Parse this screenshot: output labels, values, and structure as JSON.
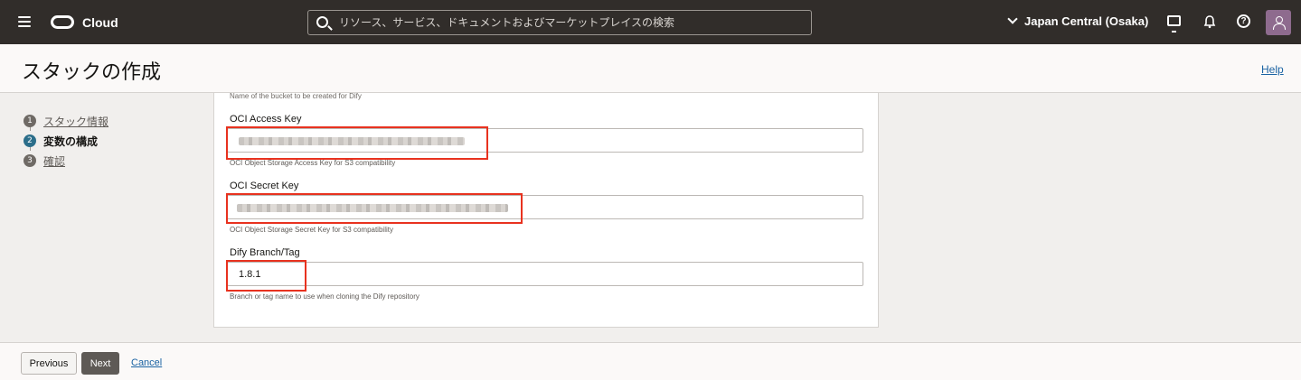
{
  "topbar": {
    "brand": "Cloud",
    "search_placeholder": "リソース、サービス、ドキュメントおよびマーケットプレイスの検索",
    "region": "Japan Central (Osaka)",
    "icons": [
      "menu-icon",
      "oracle-logo",
      "search-icon",
      "chevron-down-icon",
      "cloud-shell-icon",
      "bell-icon",
      "help-icon",
      "user-avatar-icon"
    ]
  },
  "header": {
    "title": "スタックの作成",
    "help": "Help"
  },
  "steps": [
    {
      "num": "1",
      "label": "スタック情報",
      "active": false
    },
    {
      "num": "2",
      "label": "変数の構成",
      "active": true
    },
    {
      "num": "3",
      "label": "確認",
      "active": false
    }
  ],
  "form": {
    "bucket_helper": "Name of the bucket to be created for Dify",
    "access_key": {
      "label": "OCI Access Key",
      "helper": "OCI Object Storage Access Key for S3 compatibility"
    },
    "secret_key": {
      "label": "OCI Secret Key",
      "helper": "OCI Object Storage Secret Key for S3 compatibility"
    },
    "branch": {
      "label": "Dify Branch/Tag",
      "value": "1.8.1",
      "helper": "Branch or tag name to use when cloning the Dify repository"
    }
  },
  "footer": {
    "previous": "Previous",
    "next": "Next",
    "cancel": "Cancel"
  },
  "colors": {
    "topbar": "#312d2a",
    "active_step": "#2c6e8a",
    "link": "#1b63a3",
    "highlight": "#e8321f"
  }
}
